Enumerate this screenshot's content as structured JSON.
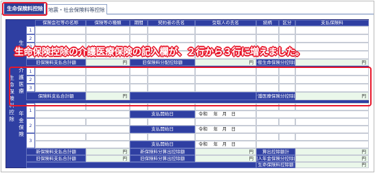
{
  "tabs": [
    {
      "label": "生命保険料控除"
    },
    {
      "label": "地震・社会保険料等控除"
    }
  ],
  "section_label": "生命保険料控除",
  "group_labels": {
    "life": "生命",
    "care": "介護医療",
    "pension": "年金保険"
  },
  "columns": [
    "保険会社等の名称",
    "保険等の種類",
    "期間",
    "契約者の氏名",
    "受取人の氏名",
    "続柄",
    "区分",
    "支払保険料"
  ],
  "row_numbers": [
    "1",
    "2",
    "3"
  ],
  "banner_text": "生命保険控除の介護医療保険の記入欄が、２行から３行に増えました。",
  "life_footer": {
    "old_total": "旧保険料支払合計額",
    "old_alloc": "旧保険料分配控除額",
    "general_deduction": "一般生命保険分控除額",
    "yen": "円"
  },
  "care_footer": {
    "total": "保険料支払合計額",
    "deduction": "介護医療保険分控除額",
    "yen": "円"
  },
  "pension": {
    "start_label": "支払開始日",
    "date_template": "令和　 年　月　日"
  },
  "pension_footer": {
    "new_total": "新保険料支払合計額",
    "old_total": "旧保険料支払合計額",
    "new_alloc": "新保険料分算出控除額",
    "old_alloc": "旧保険料分算出控除額",
    "calc_deduction": "算出控除額計",
    "pension_deduction": "個人年金保険分控除額",
    "life_deduction": "生命保険料控除額",
    "yen": "円"
  },
  "colors": {
    "header_blue": "#2f3fa2",
    "input_green": "#eaf7ea",
    "highlight_red": "#e8172b"
  }
}
